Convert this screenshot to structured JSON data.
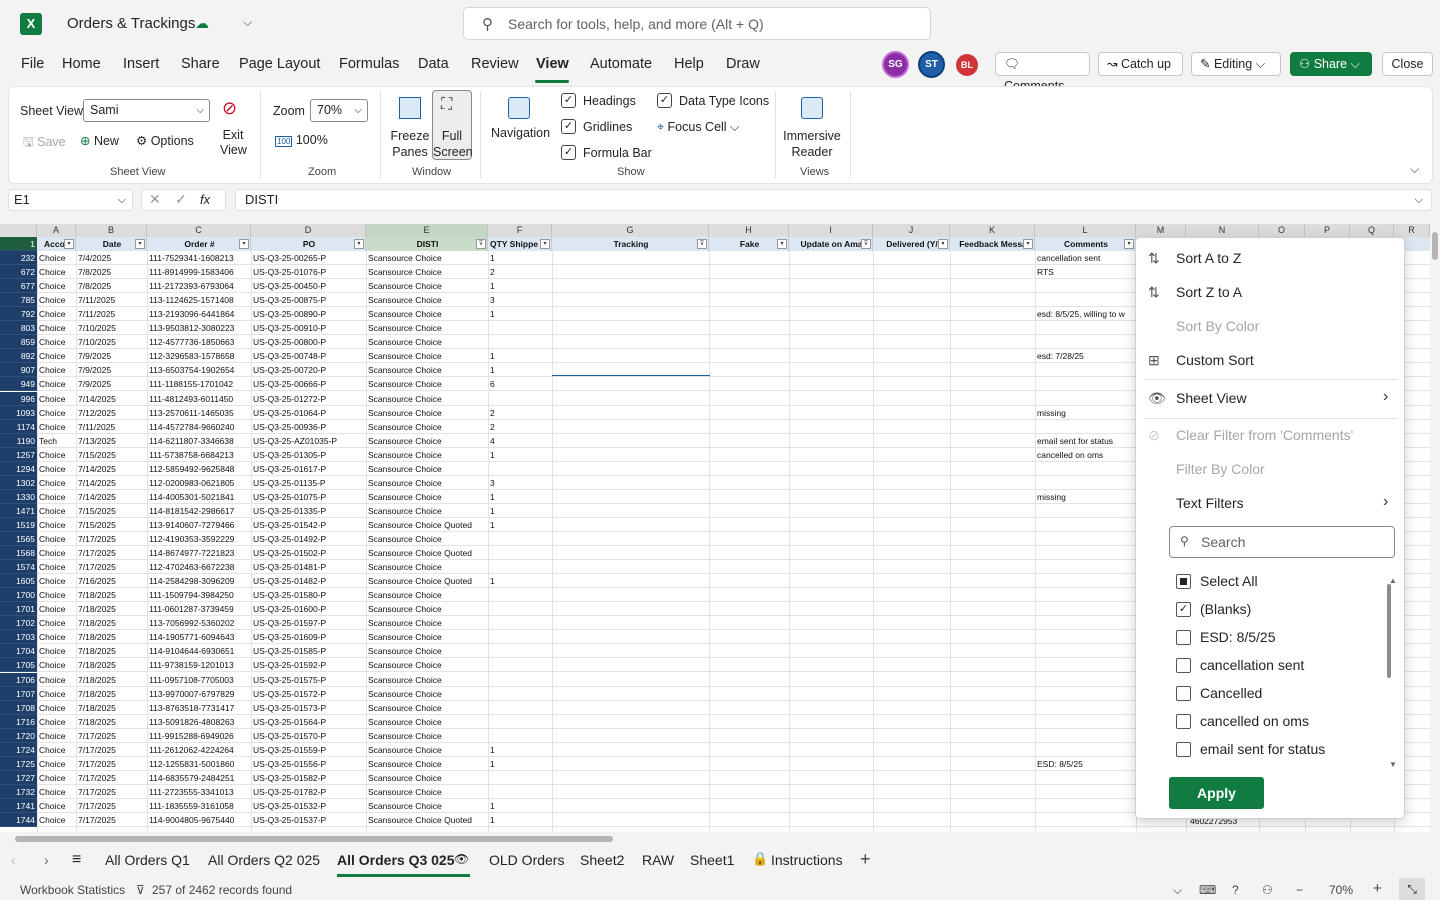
{
  "app": {
    "title": "Orders & Trackings",
    "search_placeholder": "Search for tools, help, and more (Alt + Q)"
  },
  "menu": [
    "File",
    "Home",
    "Insert",
    "Share",
    "Page Layout",
    "Formulas",
    "Data",
    "Review",
    "View",
    "Automate",
    "Help",
    "Draw"
  ],
  "avatars": [
    {
      "initials": "SG",
      "color": "#8b2ea3"
    },
    {
      "initials": "ST",
      "color": "#1f5fa8"
    },
    {
      "initials": "BL",
      "color": "#d13438"
    }
  ],
  "header_buttons": {
    "comments": "Comments",
    "catchup": "Catch up",
    "editing": "Editing",
    "share": "Share",
    "close": "Close"
  },
  "ribbon": {
    "sheet_view_label": "Sheet View",
    "sheet_view_value": "Sami",
    "save": "Save",
    "new": "New",
    "options": "Options",
    "exit_view": "Exit View",
    "group_sheet_view": "Sheet View",
    "zoom_label": "Zoom",
    "zoom_value": "70%",
    "zoom_100": "100%",
    "group_zoom": "Zoom",
    "freeze_panes": "Freeze Panes",
    "full_screen": "Full Screen",
    "group_window": "Window",
    "navigation": "Navigation",
    "headings": "Headings",
    "gridlines": "Gridlines",
    "formula_bar": "Formula Bar",
    "data_type_icons": "Data Type Icons",
    "focus_cell": "Focus Cell",
    "group_show": "Show",
    "immersive_reader": "Immersive Reader",
    "group_views": "Views"
  },
  "formula_bar": {
    "cell_ref": "E1",
    "content": "DISTI"
  },
  "columns": [
    "A",
    "B",
    "C",
    "D",
    "E",
    "F",
    "G",
    "H",
    "I",
    "J",
    "K",
    "L",
    "M",
    "N",
    "O",
    "P",
    "Q",
    "R"
  ],
  "headers": [
    "Accou",
    "Date",
    "Order #",
    "PO",
    "DISTI",
    "QTY Shippe",
    "Tracking",
    "Fake",
    "Update on Ama",
    "Delivered (Y/",
    "Feedback Messa",
    "Comments"
  ],
  "rows": [
    {
      "n": "232",
      "a": "Choice",
      "b": "7/4/2025",
      "c": "111-7529341-1608213",
      "d": "US-Q3-25-00265-P",
      "e": "Scansource Choice",
      "f": "1",
      "l": "cancellation sent"
    },
    {
      "n": "672",
      "a": "Choice",
      "b": "7/8/2025",
      "c": "111-8914999-1583406",
      "d": "US-Q3-25-01076-P",
      "e": "Scansource Choice",
      "f": "2",
      "l": "RTS"
    },
    {
      "n": "677",
      "a": "Choice",
      "b": "7/8/2025",
      "c": "111-2172393-6793064",
      "d": "US-Q3-25-00450-P",
      "e": "Scansource Choice",
      "f": "1",
      "l": ""
    },
    {
      "n": "785",
      "a": "Choice",
      "b": "7/11/2025",
      "c": "113-1124625-1571408",
      "d": "US-Q3-25-00875-P",
      "e": "Scansource Choice",
      "f": "3",
      "l": ""
    },
    {
      "n": "792",
      "a": "Choice",
      "b": "7/11/2025",
      "c": "113-2193096-6441864",
      "d": "US-Q3-25-00890-P",
      "e": "Scansource Choice",
      "f": "1",
      "l": "esd: 8/5/25, willing to w"
    },
    {
      "n": "803",
      "a": "Choice",
      "b": "7/10/2025",
      "c": "113-9503812-3080223",
      "d": "US-Q3-25-00910-P",
      "e": "Scansource Choice",
      "f": "",
      "l": ""
    },
    {
      "n": "859",
      "a": "Choice",
      "b": "7/10/2025",
      "c": "112-4577736-1850663",
      "d": "US-Q3-25-00800-P",
      "e": "Scansource Choice",
      "f": "",
      "l": ""
    },
    {
      "n": "892",
      "a": "Choice",
      "b": "7/9/2025",
      "c": "112-3296583-1578658",
      "d": "US-Q3-25-00748-P",
      "e": "Scansource Choice",
      "f": "1",
      "l": "esd: 7/28/25"
    },
    {
      "n": "907",
      "a": "Choice",
      "b": "7/9/2025",
      "c": "113-6503754-1902654",
      "d": "US-Q3-25-00720-P",
      "e": "Scansource Choice",
      "f": "1",
      "l": ""
    },
    {
      "n": "949",
      "a": "Choice",
      "b": "7/9/2025",
      "c": "111-1188155-1701042",
      "d": "US-Q3-25-00666-P",
      "e": "Scansource Choice",
      "f": "6",
      "l": ""
    },
    {
      "n": "996",
      "a": "Choice",
      "b": "7/14/2025",
      "c": "111-4812493-6011450",
      "d": "US-Q3-25-01272-P",
      "e": "Scansource Choice",
      "f": "",
      "l": ""
    },
    {
      "n": "1093",
      "a": "Choice",
      "b": "7/12/2025",
      "c": "113-2570611-1465035",
      "d": "US-Q3-25-01064-P",
      "e": "Scansource Choice",
      "f": "2",
      "l": "missing"
    },
    {
      "n": "1174",
      "a": "Choice",
      "b": "7/11/2025",
      "c": "114-4572784-9660240",
      "d": "US-Q3-25-00936-P",
      "e": "Scansource Choice",
      "f": "2",
      "l": ""
    },
    {
      "n": "1190",
      "a": "Tech",
      "b": "7/13/2025",
      "c": "114-6211807-3346638",
      "d": "US-Q3-25-AZ01035-P",
      "e": "Scansource Choice",
      "f": "4",
      "l": "email sent for status"
    },
    {
      "n": "1257",
      "a": "Choice",
      "b": "7/15/2025",
      "c": "111-5738758-6684213",
      "d": "US-Q3-25-01305-P",
      "e": "Scansource Choice",
      "f": "1",
      "l": "cancelled on oms"
    },
    {
      "n": "1294",
      "a": "Choice",
      "b": "7/14/2025",
      "c": "112-5859492-9625848",
      "d": "US-Q3-25-01617-P",
      "e": "Scansource Choice",
      "f": "",
      "l": ""
    },
    {
      "n": "1302",
      "a": "Choice",
      "b": "7/14/2025",
      "c": "112-0200983-0621805",
      "d": "US-Q3-25-01135-P",
      "e": "Scansource Choice",
      "f": "3",
      "l": ""
    },
    {
      "n": "1330",
      "a": "Choice",
      "b": "7/14/2025",
      "c": "114-4005301-5021841",
      "d": "US-Q3-25-01075-P",
      "e": "Scansource Choice",
      "f": "1",
      "l": "missing"
    },
    {
      "n": "1471",
      "a": "Choice",
      "b": "7/15/2025",
      "c": "114-8181542-2986617",
      "d": "US-Q3-25-01335-P",
      "e": "Scansource Choice",
      "f": "1",
      "l": ""
    },
    {
      "n": "1519",
      "a": "Choice",
      "b": "7/15/2025",
      "c": "113-9140607-7279466",
      "d": "US-Q3-25-01542-P",
      "e": "Scansource Choice Quoted",
      "f": "1",
      "l": ""
    },
    {
      "n": "1565",
      "a": "Choice",
      "b": "7/17/2025",
      "c": "112-4190353-3592229",
      "d": "US-Q3-25-01492-P",
      "e": "Scansource Choice",
      "f": "",
      "l": ""
    },
    {
      "n": "1568",
      "a": "Choice",
      "b": "7/17/2025",
      "c": "114-8674977-7221823",
      "d": "US-Q3-25-01502-P",
      "e": "Scansource Choice Quoted",
      "f": "",
      "l": ""
    },
    {
      "n": "1574",
      "a": "Choice",
      "b": "7/17/2025",
      "c": "112-4702463-6672238",
      "d": "US-Q3-25-01481-P",
      "e": "Scansource Choice",
      "f": "",
      "l": ""
    },
    {
      "n": "1605",
      "a": "Choice",
      "b": "7/16/2025",
      "c": "114-2584298-3096209",
      "d": "US-Q3-25-01482-P",
      "e": "Scansource Choice Quoted",
      "f": "1",
      "l": ""
    },
    {
      "n": "1700",
      "a": "Choice",
      "b": "7/18/2025",
      "c": "111-1509794-3984250",
      "d": "US-Q3-25-01580-P",
      "e": "Scansource Choice",
      "f": "",
      "l": ""
    },
    {
      "n": "1701",
      "a": "Choice",
      "b": "7/18/2025",
      "c": "111-0601287-3739459",
      "d": "US-Q3-25-01600-P",
      "e": "Scansource Choice",
      "f": "",
      "l": ""
    },
    {
      "n": "1702",
      "a": "Choice",
      "b": "7/18/2025",
      "c": "113-7056992-5360202",
      "d": "US-Q3-25-01597-P",
      "e": "Scansource Choice",
      "f": "",
      "l": ""
    },
    {
      "n": "1703",
      "a": "Choice",
      "b": "7/18/2025",
      "c": "114-1905771-6094643",
      "d": "US-Q3-25-01609-P",
      "e": "Scansource Choice",
      "f": "",
      "l": ""
    },
    {
      "n": "1704",
      "a": "Choice",
      "b": "7/18/2025",
      "c": "114-9104644-6930651",
      "d": "US-Q3-25-01585-P",
      "e": "Scansource Choice",
      "f": "",
      "l": ""
    },
    {
      "n": "1705",
      "a": "Choice",
      "b": "7/18/2025",
      "c": "111-9738159-1201013",
      "d": "US-Q3-25-01592-P",
      "e": "Scansource Choice",
      "f": "",
      "l": ""
    },
    {
      "n": "1706",
      "a": "Choice",
      "b": "7/18/2025",
      "c": "111-0957108-7705003",
      "d": "US-Q3-25-01575-P",
      "e": "Scansource Choice",
      "f": "",
      "l": ""
    },
    {
      "n": "1707",
      "a": "Choice",
      "b": "7/18/2025",
      "c": "113-9970007-6797829",
      "d": "US-Q3-25-01572-P",
      "e": "Scansource Choice",
      "f": "",
      "l": ""
    },
    {
      "n": "1708",
      "a": "Choice",
      "b": "7/18/2025",
      "c": "113-8763518-7731417",
      "d": "US-Q3-25-01573-P",
      "e": "Scansource Choice",
      "f": "",
      "l": ""
    },
    {
      "n": "1716",
      "a": "Choice",
      "b": "7/18/2025",
      "c": "113-5091826-4808263",
      "d": "US-Q3-25-01564-P",
      "e": "Scansource Choice",
      "f": "",
      "l": ""
    },
    {
      "n": "1720",
      "a": "Choice",
      "b": "7/17/2025",
      "c": "111-9915288-6949026",
      "d": "US-Q3-25-01570-P",
      "e": "Scansource Choice",
      "f": "",
      "l": ""
    },
    {
      "n": "1724",
      "a": "Choice",
      "b": "7/17/2025",
      "c": "111-2612062-4224264",
      "d": "US-Q3-25-01559-P",
      "e": "Scansource Choice",
      "f": "1",
      "l": ""
    },
    {
      "n": "1725",
      "a": "Choice",
      "b": "7/17/2025",
      "c": "112-1255831-5001860",
      "d": "US-Q3-25-01556-P",
      "e": "Scansource Choice",
      "f": "1",
      "l": "ESD:  8/5/25"
    },
    {
      "n": "1727",
      "a": "Choice",
      "b": "7/17/2025",
      "c": "114-6835579-2484251",
      "d": "US-Q3-25-01582-P",
      "e": "Scansource Choice",
      "f": "",
      "l": ""
    },
    {
      "n": "1732",
      "a": "Choice",
      "b": "7/17/2025",
      "c": "111-2723555-3341013",
      "d": "US-Q3-25-01782-P",
      "e": "Scansource Choice",
      "f": "",
      "l": ""
    },
    {
      "n": "1741",
      "a": "Choice",
      "b": "7/17/2025",
      "c": "111-1835559-3161058",
      "d": "US-Q3-25-01532-P",
      "e": "Scansource Choice",
      "f": "1",
      "l": ""
    },
    {
      "n": "1744",
      "a": "Choice",
      "b": "7/17/2025",
      "c": "114-9004805-9675440",
      "d": "US-Q3-25-01537-P",
      "e": "Scansource Choice Quoted",
      "f": "1",
      "l": ""
    }
  ],
  "col_n_partial": [
    "4602272953"
  ],
  "dropdown": {
    "sort_az": "Sort A to Z",
    "sort_za": "Sort Z to A",
    "sort_by_color": "Sort By Color",
    "custom_sort": "Custom Sort",
    "sheet_view": "Sheet View",
    "clear_filter": "Clear Filter from 'Comments'",
    "filter_by_color": "Filter By Color",
    "text_filters": "Text Filters",
    "search_placeholder": "Search",
    "items": [
      {
        "label": "Select All",
        "state": "partial"
      },
      {
        "label": "(Blanks)",
        "state": "checked"
      },
      {
        "label": "ESD:  8/5/25",
        "state": "unchecked"
      },
      {
        "label": "cancellation sent",
        "state": "unchecked"
      },
      {
        "label": "Cancelled",
        "state": "unchecked"
      },
      {
        "label": "cancelled on oms",
        "state": "unchecked"
      },
      {
        "label": "email sent for status",
        "state": "unchecked"
      }
    ],
    "apply": "Apply"
  },
  "tabs": [
    "All Orders Q1",
    "All Orders Q2 025",
    "All Orders Q3 025",
    "OLD Orders",
    "Sheet2",
    "RAW",
    "Sheet1",
    "Instructions"
  ],
  "active_tab": "All Orders Q3 025",
  "status": {
    "workbook_stats": "Workbook Statistics",
    "records": "257 of 2462 records found",
    "zoom": "70%"
  },
  "colors": {
    "accent": "#107c41",
    "row_header": "#1f3f6a",
    "header_fill": "#dde7f3"
  }
}
